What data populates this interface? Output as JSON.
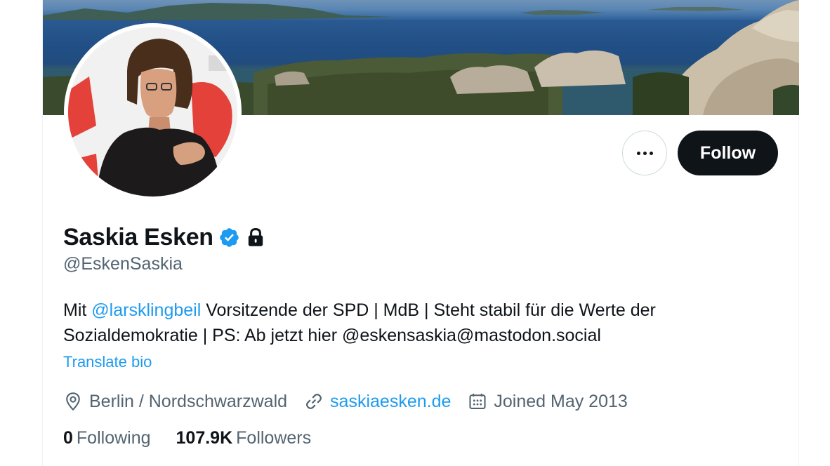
{
  "profile": {
    "display_name": "Saskia Esken",
    "handle": "@EskenSaskia",
    "bio": {
      "prefix": "Mit ",
      "mention": "@larsklingbeil",
      "rest": " Vorsitzende der SPD | MdB | Steht stabil für die Werte der Sozialdemokratie | PS: Ab jetzt hier @eskensaskia@mastodon.social"
    },
    "translate_label": "Translate bio",
    "location": "Berlin / Nordschwarzwald",
    "website": "saskiaesken.de",
    "joined": "Joined May 2013"
  },
  "actions": {
    "follow_label": "Follow"
  },
  "stats": {
    "following_count": "0",
    "following_label": "Following",
    "followers_count": "107.9K",
    "followers_label": "Followers"
  },
  "icons": {
    "verified": "verified-badge-icon",
    "protected": "lock-icon",
    "location": "location-pin-icon",
    "link": "link-icon",
    "calendar": "calendar-icon",
    "more": "more-dots-icon"
  },
  "colors": {
    "accent": "#1d9bf0",
    "text": "#0f1419",
    "secondary": "#536471",
    "follow_button": "#0f1419"
  }
}
